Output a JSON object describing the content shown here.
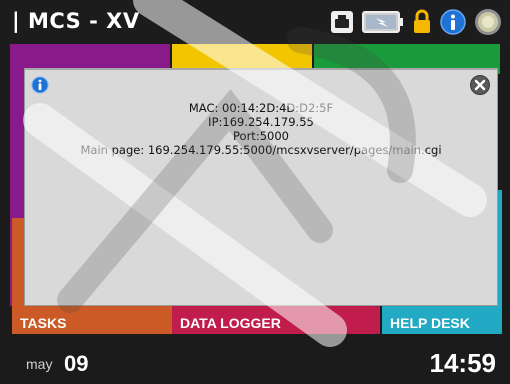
{
  "app": {
    "title": "| MCS - XV"
  },
  "status_icons": [
    "printer-icon",
    "battery-charging-icon",
    "lock-icon",
    "info-icon",
    "power-button-icon"
  ],
  "tiles": {
    "tasks": "TASKS",
    "data_logger": "DATA LOGGER",
    "help_desk": "HELP DESK"
  },
  "dialog": {
    "mac": "MAC: 00:14:2D:4D:D2:5F",
    "ip": "IP:169.254.179.55",
    "port": "Port:5000",
    "main_page": "Main page: 169.254.179.55:5000/mcsxvserver/pages/main.cgi"
  },
  "footer": {
    "month": "may",
    "day": "09",
    "time": "14:59"
  },
  "colors": {
    "purple": "#8a1a8a",
    "yellow": "#f1c500",
    "green": "#1a9a3a",
    "cyan": "#22a9c4",
    "orange": "#cc5a26",
    "magenta": "#c01c4c",
    "info_blue": "#1f73d6",
    "lock_yellow": "#f5b800"
  }
}
